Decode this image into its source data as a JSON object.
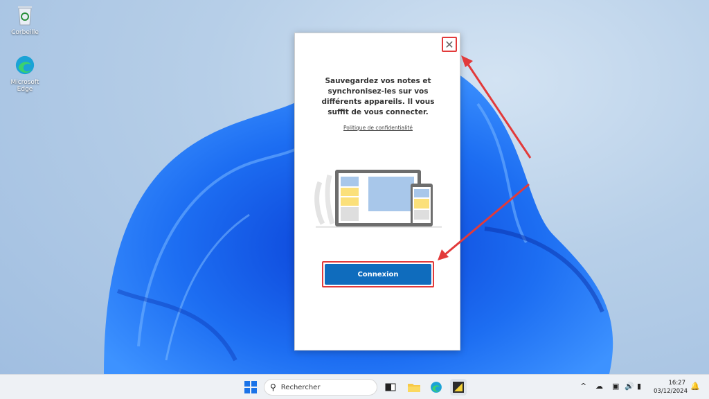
{
  "desktop": {
    "icons": [
      {
        "label": "Corbeille",
        "icon": "recycle-bin-icon"
      },
      {
        "label": "Microsoft Edge",
        "icon": "edge-icon"
      }
    ]
  },
  "dialog": {
    "message": "Sauvegardez vos notes et synchronisez-les sur vos différents appareils. Il vous suffit de vous connecter.",
    "privacy_link": "Politique de confidentialité",
    "primary_button": "Connexion",
    "close_glyph": "✕",
    "highlight_color": "#e23a3a",
    "accent_color": "#0f6cbd"
  },
  "taskbar": {
    "search_placeholder": "Rechercher",
    "apps": [
      "start-icon",
      "task-view-icon",
      "file-explorer-icon",
      "edge-icon",
      "sticky-notes-icon"
    ],
    "tray": [
      "chevron-up-icon",
      "cloud-icon",
      "display-icon",
      "volume-icon",
      "battery-icon"
    ],
    "time": "16:27",
    "date": "03/12/2024",
    "notification_icon": "bell-icon"
  }
}
